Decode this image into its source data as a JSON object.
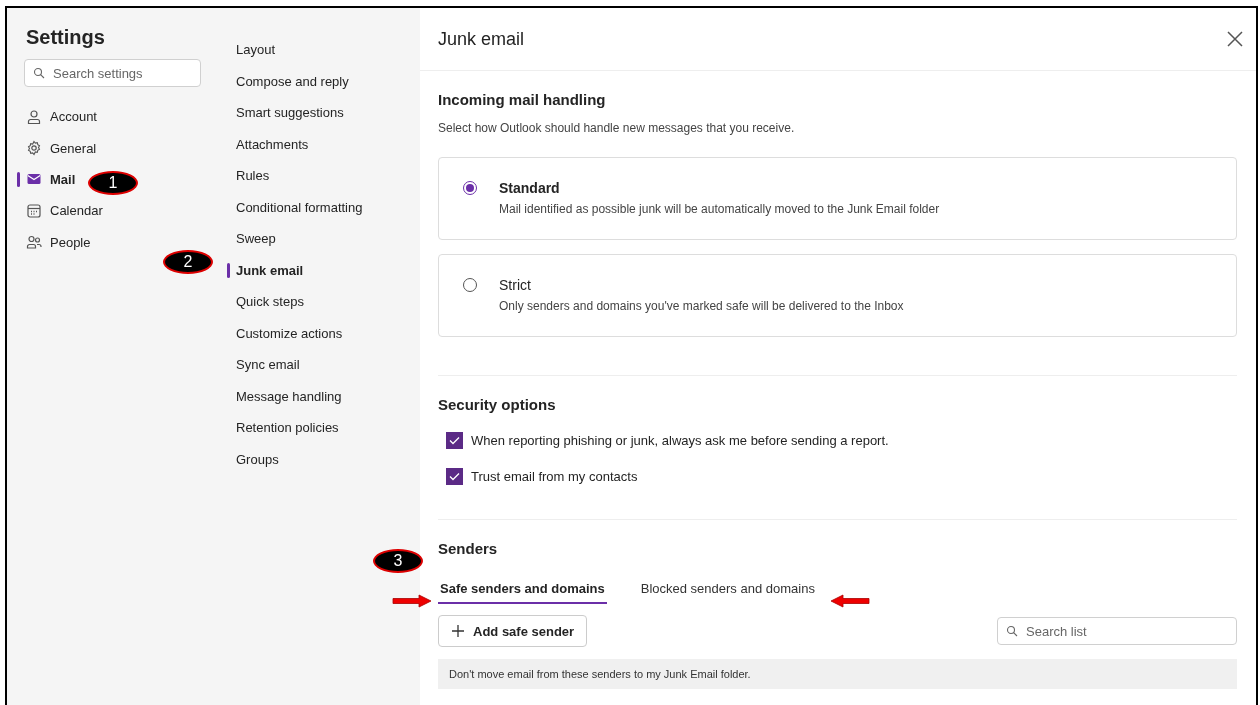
{
  "sidebar": {
    "title": "Settings",
    "search": {
      "placeholder": "Search settings"
    },
    "items": [
      {
        "label": "Account",
        "selected": false
      },
      {
        "label": "General",
        "selected": false
      },
      {
        "label": "Mail",
        "selected": true
      },
      {
        "label": "Calendar",
        "selected": false
      },
      {
        "label": "People",
        "selected": false
      }
    ]
  },
  "subnav": {
    "items": [
      {
        "label": "Layout",
        "selected": false
      },
      {
        "label": "Compose and reply",
        "selected": false
      },
      {
        "label": "Smart suggestions",
        "selected": false
      },
      {
        "label": "Attachments",
        "selected": false
      },
      {
        "label": "Rules",
        "selected": false
      },
      {
        "label": "Conditional formatting",
        "selected": false
      },
      {
        "label": "Sweep",
        "selected": false
      },
      {
        "label": "Junk email",
        "selected": true
      },
      {
        "label": "Quick steps",
        "selected": false
      },
      {
        "label": "Customize actions",
        "selected": false
      },
      {
        "label": "Sync email",
        "selected": false
      },
      {
        "label": "Message handling",
        "selected": false
      },
      {
        "label": "Retention policies",
        "selected": false
      },
      {
        "label": "Groups",
        "selected": false
      }
    ]
  },
  "panel": {
    "title": "Junk email",
    "incoming": {
      "heading": "Incoming mail handling",
      "description": "Select how Outlook should handle new messages that you receive.",
      "options": [
        {
          "label": "Standard",
          "description": "Mail identified as possible junk will be automatically moved to the Junk Email folder",
          "selected": true
        },
        {
          "label": "Strict",
          "description": "Only senders and domains you've marked safe will be delivered to the Inbox",
          "selected": false
        }
      ]
    },
    "security": {
      "heading": "Security options",
      "checkboxes": [
        {
          "label": "When reporting phishing or junk, always ask me before sending a report.",
          "checked": true
        },
        {
          "label": "Trust email from my contacts",
          "checked": true
        }
      ]
    },
    "senders": {
      "heading": "Senders",
      "tabs": [
        {
          "label": "Safe senders and domains",
          "selected": true
        },
        {
          "label": "Blocked senders and domains",
          "selected": false
        }
      ],
      "add_button": "Add safe sender",
      "search": {
        "placeholder": "Search list"
      },
      "info": "Don't move email from these senders to my Junk Email folder."
    }
  },
  "callouts": [
    {
      "label": "1"
    },
    {
      "label": "2"
    },
    {
      "label": "3"
    }
  ]
}
